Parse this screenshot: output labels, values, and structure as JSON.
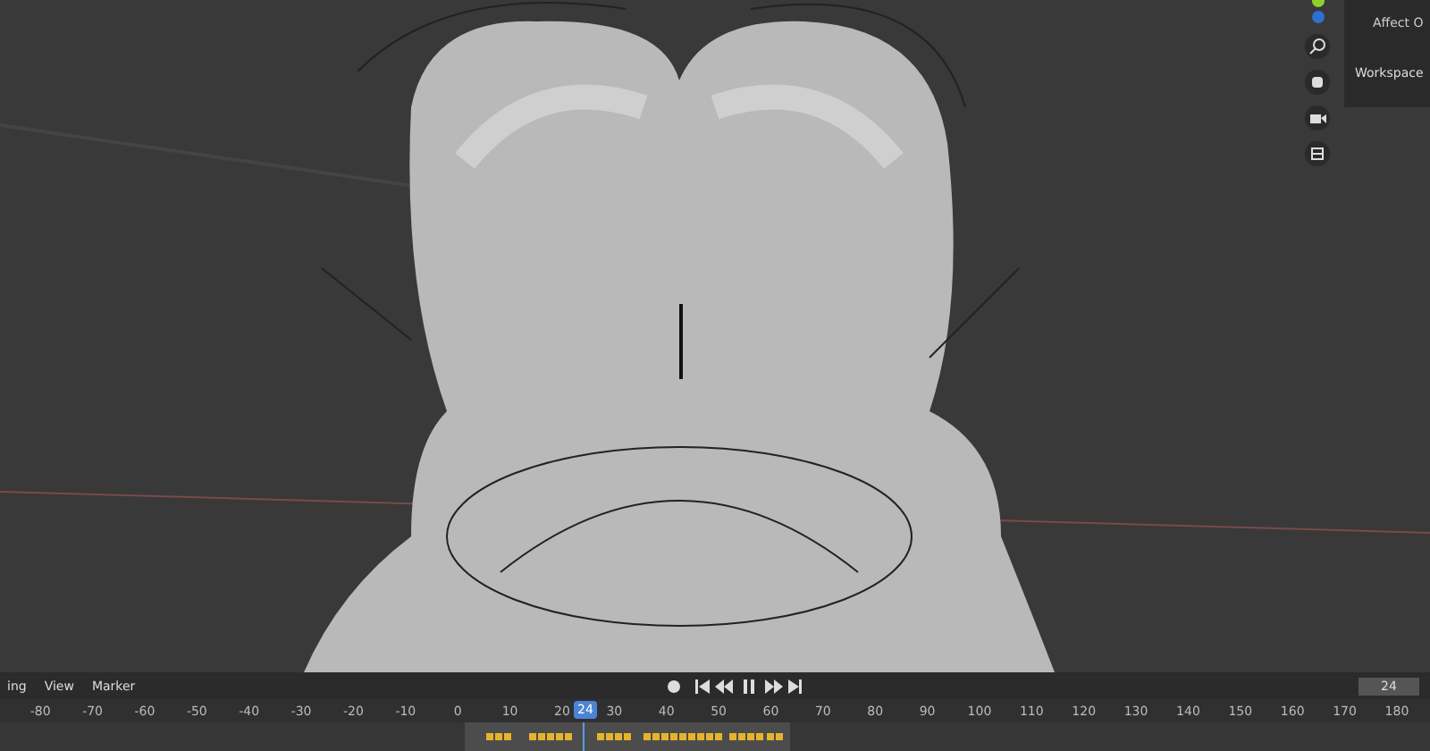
{
  "viewport": {
    "panel": {
      "items": [
        "Affect O",
        "Workspace"
      ]
    }
  },
  "timeline": {
    "menus": [
      "ing",
      "View",
      "Marker"
    ],
    "end_frame": "24",
    "current_frame": "24",
    "ticks": [
      "-80",
      "-70",
      "-60",
      "-50",
      "-40",
      "-30",
      "-20",
      "-10",
      "0",
      "10",
      "20",
      "30",
      "40",
      "50",
      "60",
      "70",
      "80",
      "90",
      "100",
      "110",
      "120",
      "130",
      "140",
      "150",
      "160",
      "170",
      "180"
    ]
  }
}
